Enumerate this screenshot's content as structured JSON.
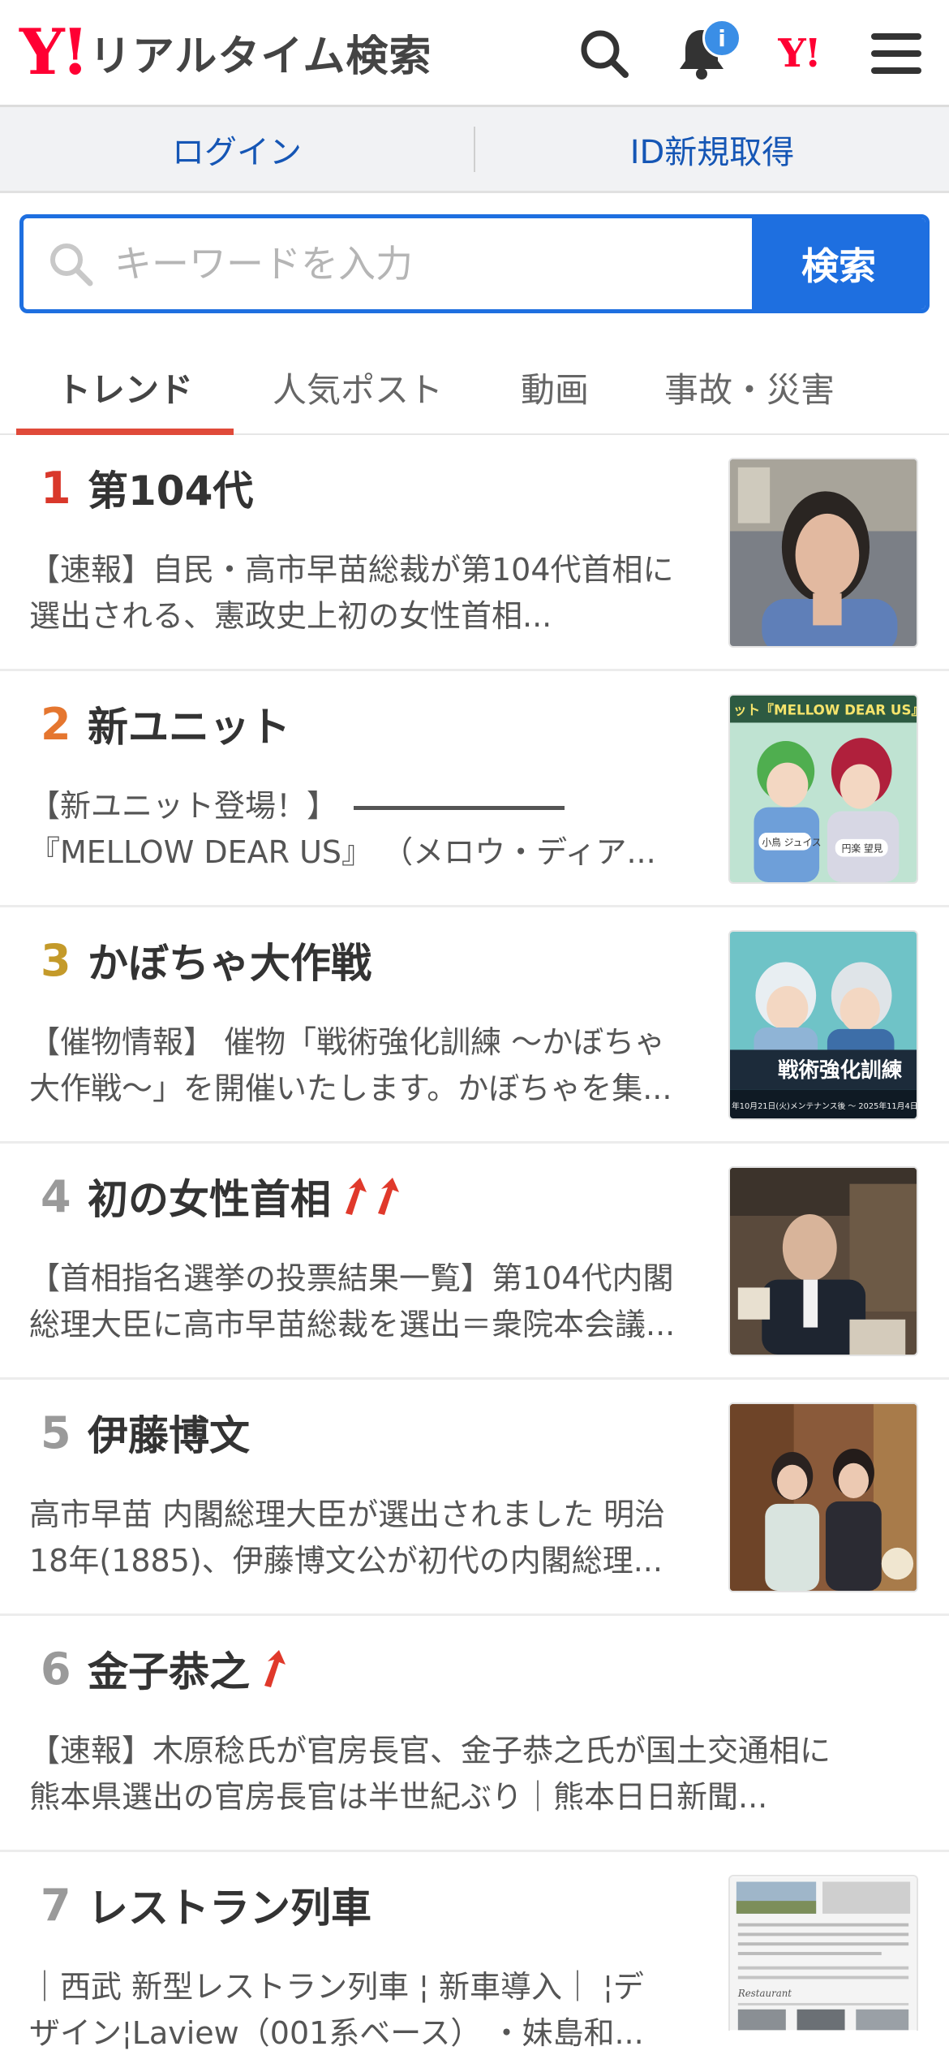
{
  "header": {
    "logo_mark": "Y!",
    "logo_text": "リアルタイム検索",
    "notification_badge": "i",
    "yahoo_mark": "Y!"
  },
  "auth": {
    "login": "ログイン",
    "register": "ID新規取得"
  },
  "search": {
    "placeholder": "キーワードを入力",
    "button": "検索"
  },
  "tabs": [
    "トレンド",
    "人気ポスト",
    "動画",
    "事故・災害"
  ],
  "trends": [
    {
      "rank": "1",
      "keyword": "第104代",
      "lines": [
        "【速報】自民・高市早苗総裁が第104代首相に",
        "選出される、憲政史上初の女性首相..."
      ]
    },
    {
      "rank": "2",
      "keyword": "新ユニット",
      "lines": [
        "【新ユニット登場！】",
        "『MELLOW DEAR US』 （メロウ・ディア..."
      ]
    },
    {
      "rank": "3",
      "keyword": "かぼちゃ大作戦",
      "lines": [
        "【催物情報】 催物「戦術強化訓練 〜かぼちゃ",
        "大作戦〜」を開催いたします。かぼちゃを集..."
      ]
    },
    {
      "rank": "4",
      "keyword": "初の女性首相",
      "lines": [
        "【首相指名選挙の投票結果一覧】第104代内閣",
        "総理大臣に高市早苗総裁を選出＝衆院本会議..."
      ]
    },
    {
      "rank": "5",
      "keyword": "伊藤博文",
      "lines": [
        "高市早苗 内閣総理大臣が選出されました 明治",
        "18年(1885)、伊藤博文公が初代の内閣総理..."
      ]
    },
    {
      "rank": "6",
      "keyword": "金子恭之",
      "lines": [
        "【速報】木原稔氏が官房長官、金子恭之氏が国土交通相に",
        "熊本県選出の官房長官は半世紀ぶり｜熊本日日新聞..."
      ]
    },
    {
      "rank": "7",
      "keyword": "レストラン列車",
      "lines": [
        "｜西武 新型レストラン列車 ¦ 新車導入｜ ¦デ",
        "ザイン¦Laview（001系ベース） ・妹島和..."
      ]
    }
  ],
  "thumb_text": {
    "t2_banner": "ット『MELLOW DEAR US』",
    "t2_name1": "小鳥 ジュイス",
    "t2_name2": "円楽 望見",
    "t3_title": "戦術強化訓練",
    "t3_date": "年10月21日(火)メンテナンス後 〜 2025年11月4日(",
    "t7_caption": "Restaurant"
  },
  "colors": {
    "accent_blue": "#1e6fe0",
    "tab_active": "#e04a3a",
    "logo_red": "#ff0033"
  }
}
